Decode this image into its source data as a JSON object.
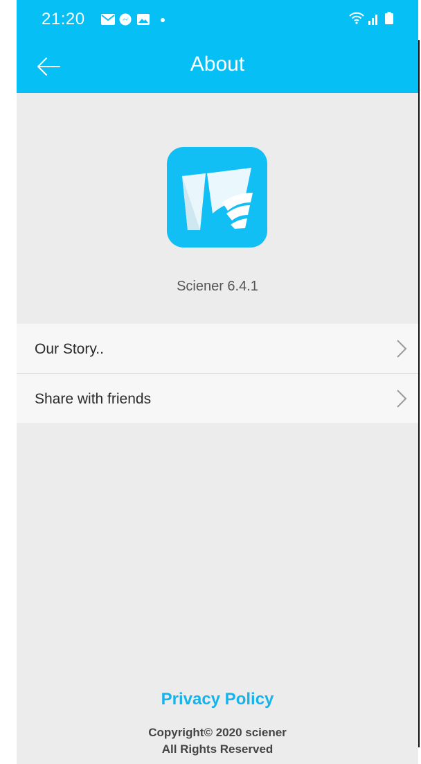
{
  "status_bar": {
    "time": "21:20",
    "left_icons": [
      "mail-icon",
      "messenger-icon",
      "gallery-icon",
      "dot-icon"
    ],
    "right_icons": [
      "wifi-icon",
      "signal-icon",
      "battery-icon"
    ]
  },
  "header": {
    "back_icon": "arrow-left-icon",
    "title": "About"
  },
  "app": {
    "logo_icon": "sciener-logo-icon",
    "version": "Sciener 6.4.1"
  },
  "menu": {
    "items": [
      {
        "label": "Our Story..",
        "icon": "chevron-right-icon"
      },
      {
        "label": "Share with friends",
        "icon": "chevron-right-icon"
      }
    ]
  },
  "footer": {
    "privacy_link": "Privacy Policy",
    "copyright_line1": "Copyright© 2020 sciener",
    "copyright_line2": "All Rights Reserved"
  },
  "colors": {
    "primary": "#06bff4",
    "background": "#ececec",
    "menu_background": "#f7f7f7",
    "link": "#15b4ec"
  }
}
